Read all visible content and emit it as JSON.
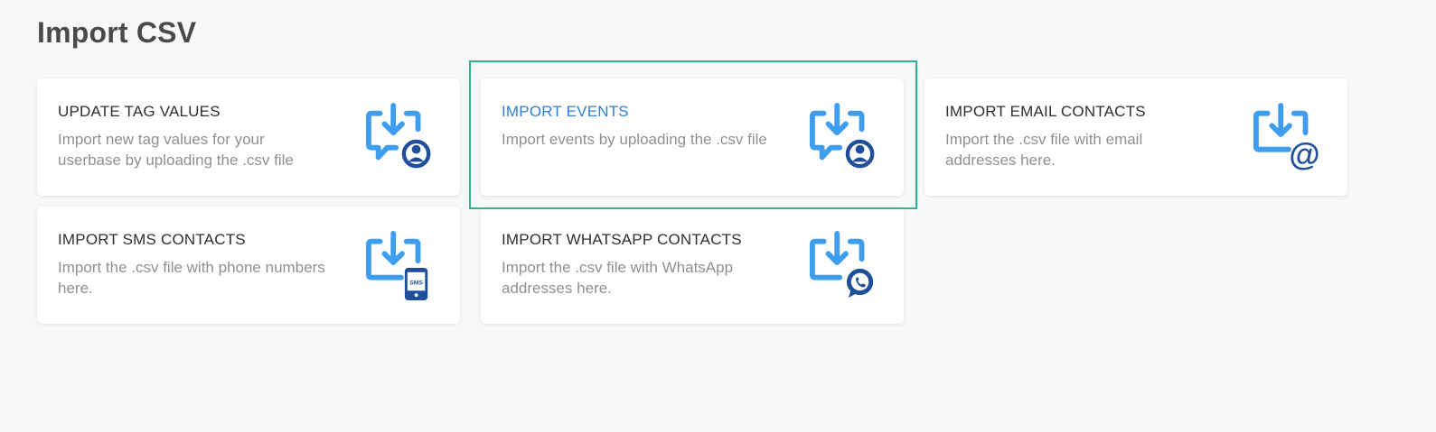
{
  "page": {
    "title": "Import CSV"
  },
  "cards": [
    {
      "title": "UPDATE TAG VALUES",
      "description": "Import new tag values for your userbase by uploading the .csv file",
      "icon": "download-user-icon"
    },
    {
      "title": "IMPORT EVENTS",
      "description": "Import events by uploading the .csv file",
      "icon": "download-user-icon",
      "selected": true
    },
    {
      "title": "IMPORT EMAIL CONTACTS",
      "description": "Import the .csv file with email addresses here.",
      "icon": "download-email-icon"
    },
    {
      "title": "IMPORT SMS CONTACTS",
      "description": "Import the .csv file with phone numbers here.",
      "icon": "download-sms-icon"
    },
    {
      "title": "IMPORT WHATSAPP CONTACTS",
      "description": "Import the .csv file with WhatsApp addresses here.",
      "icon": "download-whatsapp-icon"
    }
  ],
  "colors": {
    "icon_light_blue": "#3f9df0",
    "icon_dark_blue": "#1f4f9a",
    "active_title": "#2f7fd6",
    "selection_outline": "#2fb38a"
  }
}
